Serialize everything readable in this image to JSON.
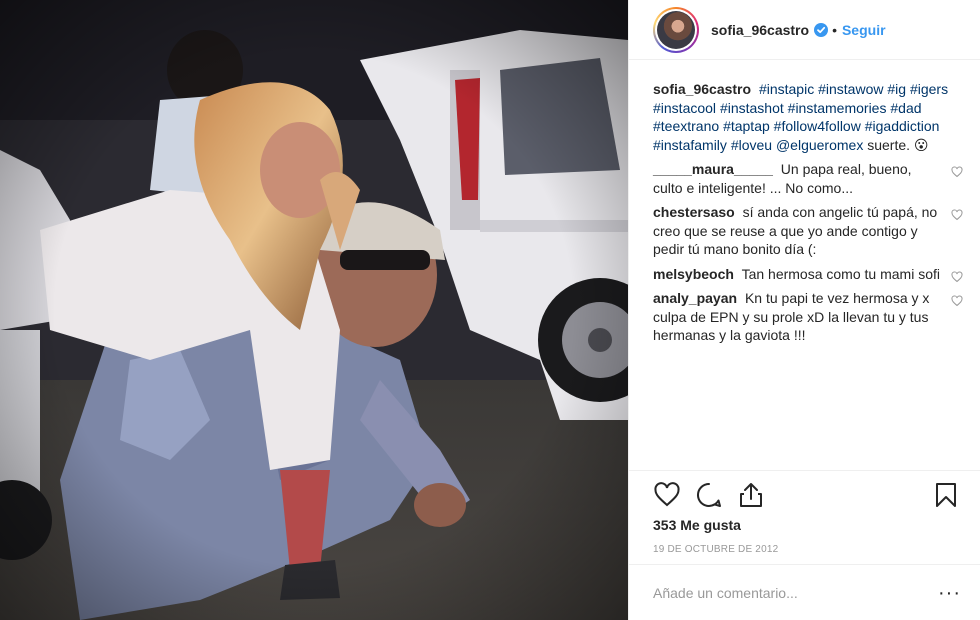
{
  "post": {
    "username": "sofia_96castro",
    "follow_label": "Seguir",
    "dot": "•",
    "caption": {
      "user": "sofia_96castro",
      "line1_tags": [
        "#instapic",
        "#instawow",
        "#ig",
        "#igers"
      ],
      "line2_tags": [
        "#instacool",
        "#instashot",
        "#instamemories",
        "#dad"
      ],
      "line3_tags": [
        "#teextrano",
        "#taptap",
        "#follow4follow"
      ],
      "line4_tags": [
        "#igaddiction",
        "#instafamily",
        "#loveu"
      ],
      "mention": "@elgueromex",
      "tail": "suerte. 😮"
    },
    "comments": [
      {
        "user": "_____maura_____",
        "text": "Un papa real, bueno, culto e inteligente! ... No como..."
      },
      {
        "user": "chestersaso",
        "text": "sí anda con angelic tú papá, no creo que se reuse a que yo ande contigo y pedir tú mano bonito día (:"
      },
      {
        "user": "melsybeoch",
        "text": "Tan hermosa como tu mami sofi"
      },
      {
        "user": "analy_payan",
        "text": "Kn tu papi te vez hermosa y x culpa de EPN y su prole xD la llevan tu y tus hermanas y la gaviota !!!"
      }
    ],
    "likes": "353 Me gusta",
    "date": "19 DE OCTUBRE DE 2012",
    "comment_placeholder": "Añade un comentario...",
    "more": "···"
  },
  "icons": {
    "verified": "verified-badge-icon",
    "like": "heart-icon",
    "comment": "comment-bubble-icon",
    "share": "share-icon",
    "save": "bookmark-icon"
  },
  "colors": {
    "link": "#3897f0",
    "tag": "#003569",
    "muted": "#999999",
    "border": "#efefef"
  }
}
